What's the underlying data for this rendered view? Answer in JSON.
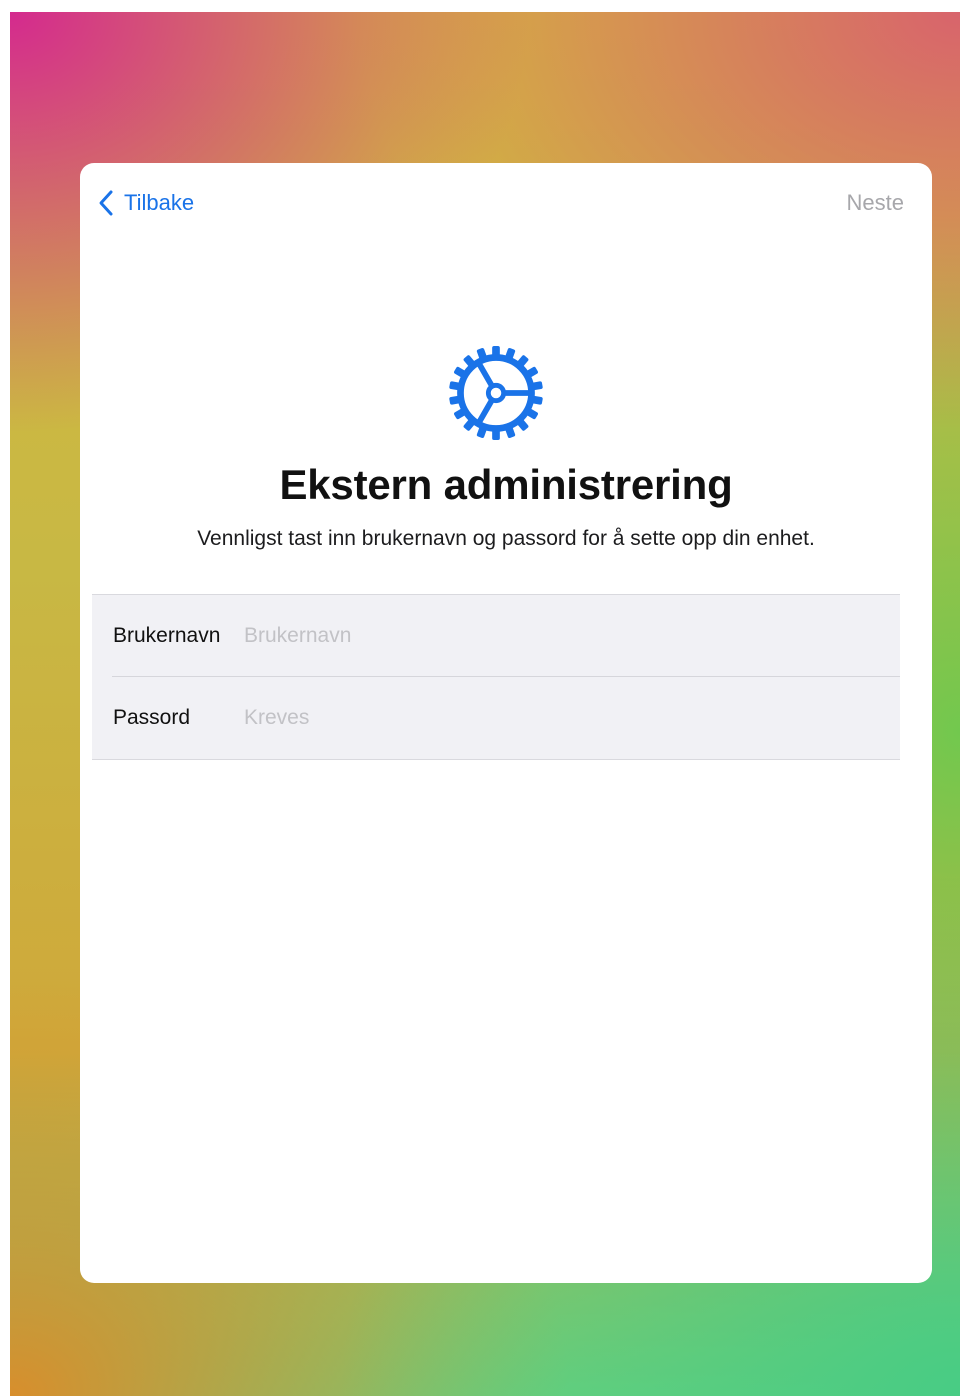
{
  "nav": {
    "back_label": "Tilbake",
    "next_label": "Neste"
  },
  "header": {
    "icon": "gear-icon",
    "title": "Ekstern administrering",
    "subtitle": "Vennligst tast inn brukernavn og passord for å sette opp din enhet."
  },
  "form": {
    "username": {
      "label": "Brukernavn",
      "placeholder": "Brukernavn",
      "value": ""
    },
    "password": {
      "label": "Passord",
      "placeholder": "Kreves",
      "value": ""
    }
  },
  "colors": {
    "accent": "#1a73e8",
    "disabled": "#a7a7ab",
    "placeholder": "#c2c2c6",
    "field_background": "#f1f1f5"
  }
}
